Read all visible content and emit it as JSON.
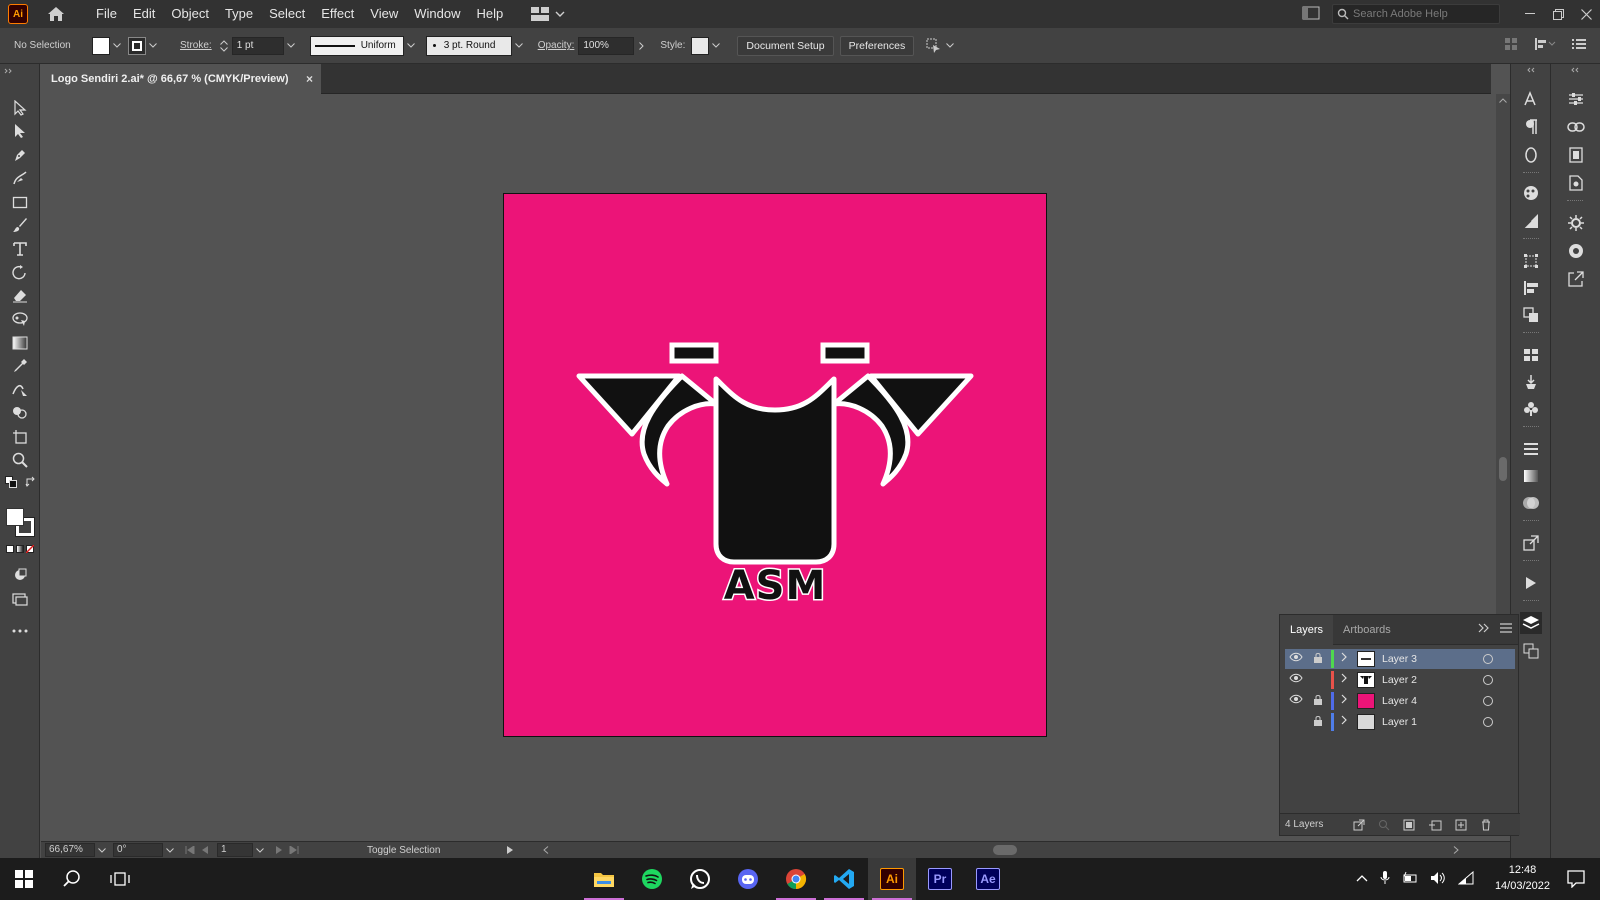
{
  "app": {
    "logo_text": "Ai",
    "menu": [
      "File",
      "Edit",
      "Object",
      "Type",
      "Select",
      "Effect",
      "View",
      "Window",
      "Help"
    ],
    "search_placeholder": "Search Adobe Help"
  },
  "control_bar": {
    "selection_status": "No Selection",
    "stroke_label": "Stroke:",
    "stroke_weight": "1 pt",
    "variable_width": "Uniform",
    "brush": "3 pt. Round",
    "opacity_label": "Opacity:",
    "opacity_value": "100%",
    "style_label": "Style:",
    "document_setup": "Document Setup",
    "preferences": "Preferences"
  },
  "document": {
    "tab_title": "Logo Sendiri 2.ai* @ 66,67 % (CMYK/Preview)",
    "close_glyph": "×"
  },
  "artwork": {
    "background_color": "#ec1478",
    "logo_text": "ASM"
  },
  "status_bar": {
    "zoom": "66,67%",
    "rotation": "0°",
    "artboard_number": "1",
    "status_text": "Toggle Selection"
  },
  "layers_panel": {
    "tabs": [
      "Layers",
      "Artboards"
    ],
    "layers": [
      {
        "name": "Layer 3",
        "visible": true,
        "locked": true,
        "color": "#4fd84f",
        "selected": true
      },
      {
        "name": "Layer 2",
        "visible": true,
        "locked": false,
        "color": "#e8524a",
        "selected": false
      },
      {
        "name": "Layer 4",
        "visible": true,
        "locked": true,
        "color": "#4f6be8",
        "selected": false
      },
      {
        "name": "Layer 1",
        "visible": false,
        "locked": true,
        "color": "#4f7de8",
        "selected": false
      }
    ],
    "count_text": "4 Layers"
  },
  "taskbar": {
    "apps": [
      "file-explorer-icon",
      "spotify-icon",
      "whatsapp-icon",
      "discord-icon",
      "chrome-icon",
      "vscode-icon",
      "illustrator-icon",
      "premiere-icon",
      "after-effects-icon"
    ],
    "ai_label": "Ai",
    "pr_label": "Pr",
    "ae_label": "Ae",
    "time": "12:48",
    "date": "14/03/2022"
  }
}
